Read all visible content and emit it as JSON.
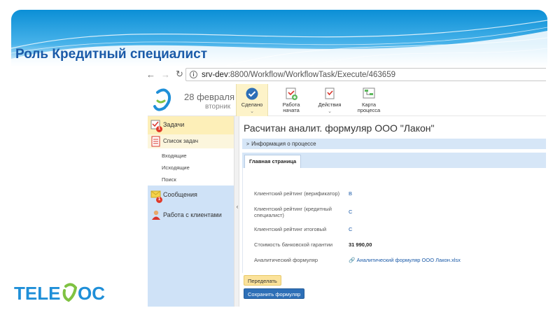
{
  "slide": {
    "title": "Роль Кредитный специалист",
    "logo_text": "TELEDOC"
  },
  "browser": {
    "back_icon": "arrow-left-icon",
    "forward_icon": "arrow-right-icon",
    "reload_icon": "reload-icon",
    "url_host": "srv-dev",
    "url_rest": ":8800/Workflow/WorkflowTask/Execute/463659"
  },
  "header": {
    "date_main": "28 февраля",
    "date_sub": "вторник",
    "tools": [
      {
        "label": "Сделано",
        "icon": "done-check-icon"
      },
      {
        "label": "Работа начата",
        "icon": "work-started-icon"
      },
      {
        "label": "Действия",
        "icon": "actions-icon"
      },
      {
        "label": "Карта процесса",
        "icon": "process-map-icon"
      }
    ]
  },
  "sidebar": {
    "tasks": "Задачи",
    "tasks_badge": "1",
    "task_list": "Список задач",
    "sub_items": [
      "Входящие",
      "Исходящие",
      "Поиск"
    ],
    "messages": "Сообщения",
    "messages_badge": "1",
    "clients": "Работа с клиентами"
  },
  "main": {
    "doc_title": "Расчитан аналит. формуляр ООО \"Лакон\"",
    "process_info": "Информация о процессе",
    "tab": "Главная страница",
    "fields": [
      {
        "label": "Клиентский рейтинг (верификатор)",
        "value": "B"
      },
      {
        "label": "Клиентский рейтинг (кредитный специалист)",
        "value": "C"
      },
      {
        "label": "Клиентский рейтинг итоговый",
        "value": "C"
      },
      {
        "label": "Стоимость банковской гарантии",
        "value": "31 990,00"
      },
      {
        "label": "Аналитический формуляр",
        "value": "Аналитический формуляр ООО Лакон.xlsx"
      }
    ],
    "reassign_button": "Переделать",
    "save_button": "Сохранить формуляр"
  },
  "colors": {
    "title": "#1a5aa8",
    "accent_blue": "#2d6fb7",
    "highlight_yellow": "#fdefb8",
    "panel_blue": "#cfe2f7"
  }
}
